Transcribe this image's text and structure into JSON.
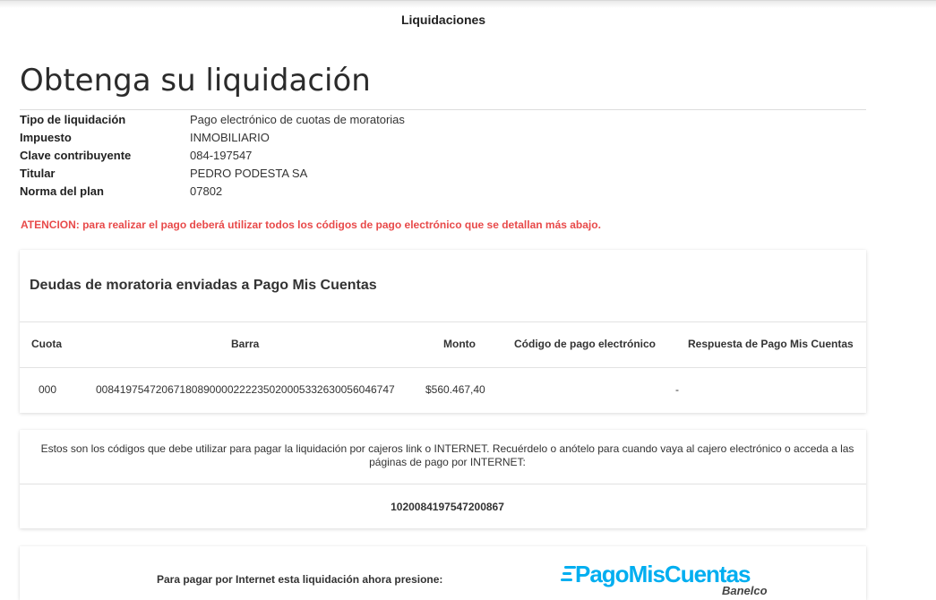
{
  "header": {
    "title": "Liquidaciones"
  },
  "page": {
    "heading": "Obtenga su liquidación"
  },
  "info": [
    {
      "label": "Tipo de liquidación",
      "value": "Pago electrónico de cuotas de moratorias"
    },
    {
      "label": "Impuesto",
      "value": "INMOBILIARIO"
    },
    {
      "label": "Clave contribuyente",
      "value": "084-197547"
    },
    {
      "label": "Titular",
      "value": "PEDRO PODESTA SA"
    },
    {
      "label": "Norma del plan",
      "value": "07802"
    }
  ],
  "warning": "ATENCION: para realizar el pago deberá utilizar todos los códigos de pago electrónico que se detallan más abajo.",
  "debts": {
    "title": "Deudas de moratoria enviadas a Pago Mis Cuentas",
    "columns": [
      "Cuota",
      "Barra",
      "Monto",
      "Código de pago electrónico",
      "Respuesta de Pago Mis Cuentas"
    ],
    "rows": [
      {
        "cuota": "000",
        "barra": "00841975472067180890000222235020005332630056046747",
        "monto": "$560.467,40",
        "codigo": "",
        "respuesta": "-"
      }
    ]
  },
  "codes": {
    "message": "Estos son los códigos que debe utilizar para pagar la liquidación por cajeros link o INTERNET. Recuérdelo o anótelo para cuando vaya al cajero electrónico o acceda a las páginas de pago por INTERNET:",
    "code": "1020084197547200867"
  },
  "payment": {
    "label": "Para pagar por Internet esta liquidación ahora presione:",
    "logo_text_1": "Pago",
    "logo_text_2": "MisCuentas",
    "logo_sub": "Banelco"
  },
  "colors": {
    "warning": "#e84a4a",
    "brand": "#00aef0"
  }
}
